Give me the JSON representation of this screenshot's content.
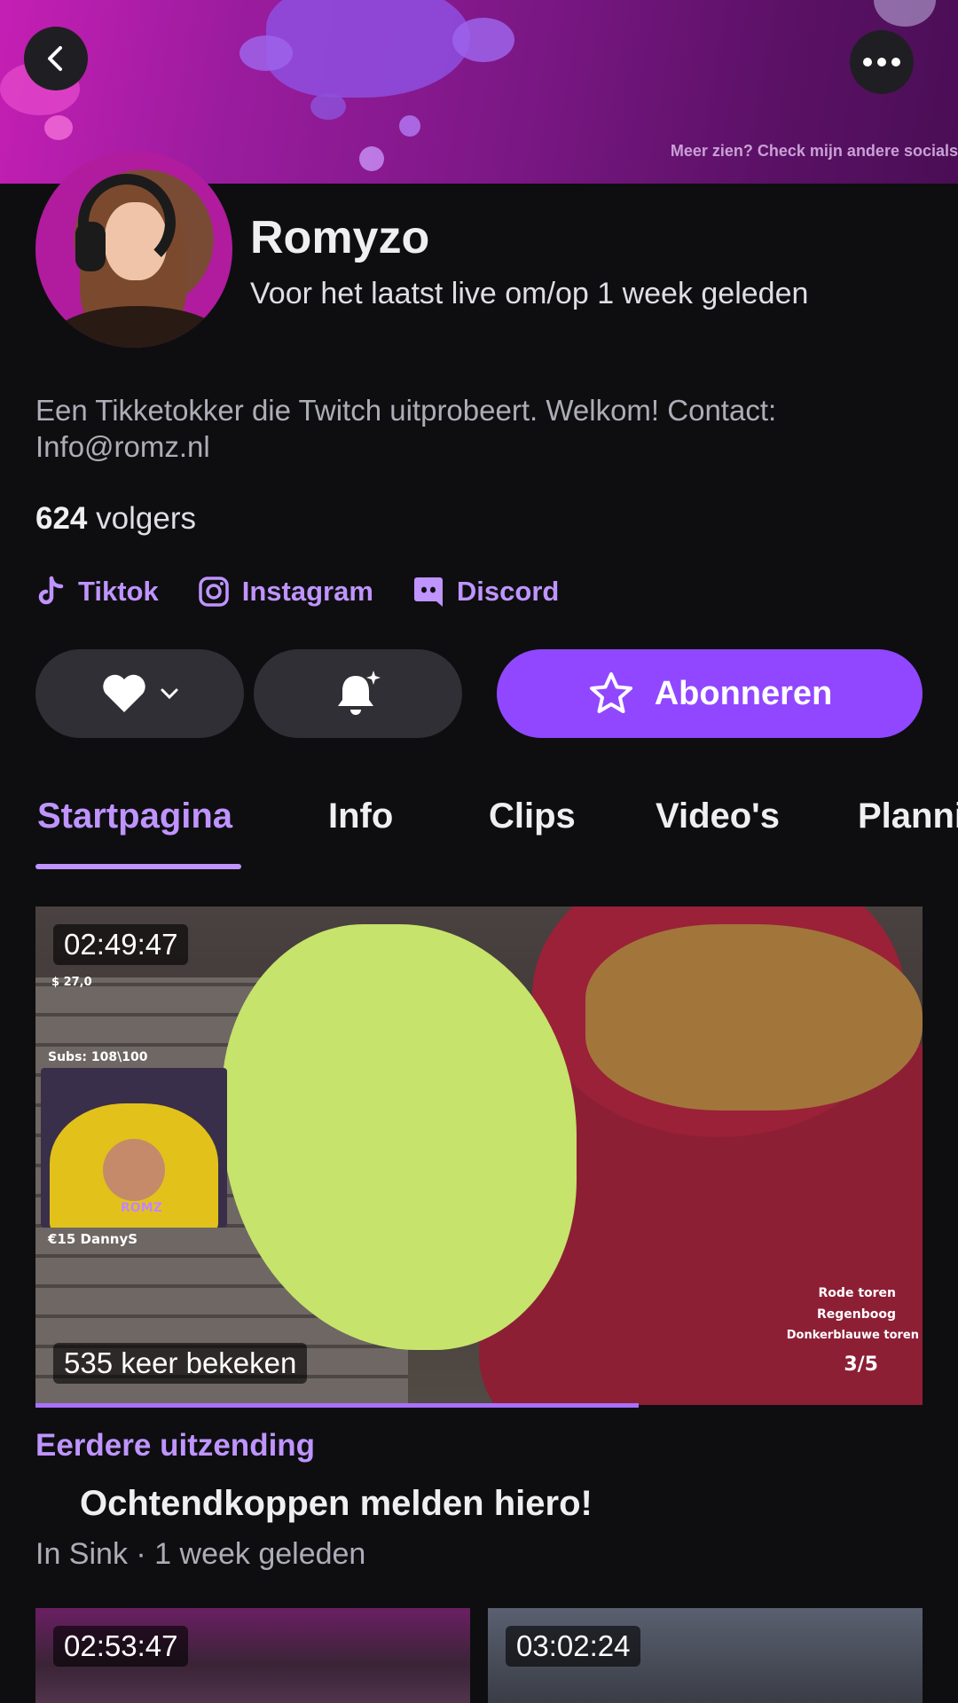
{
  "banner": {
    "text": "Meer zien? Check mijn andere socials"
  },
  "channel": {
    "name": "Romyzo",
    "last_live": "Voor het laatst live om/op 1 week geleden",
    "bio": "Een Tikketokker die Twitch uitprobeert. Welkom! Contact: Info@romz.nl",
    "followers_count": "624",
    "followers_label": "volgers"
  },
  "socials": [
    {
      "label": "Tiktok",
      "icon": "tiktok-icon"
    },
    {
      "label": "Instagram",
      "icon": "instagram-icon"
    },
    {
      "label": "Discord",
      "icon": "discord-icon"
    }
  ],
  "actions": {
    "subscribe_label": "Abonneren"
  },
  "tabs": [
    {
      "label": "Startpagina",
      "active": true
    },
    {
      "label": "Info"
    },
    {
      "label": "Clips"
    },
    {
      "label": "Video's"
    },
    {
      "label": "Planni"
    }
  ],
  "featured_video": {
    "duration": "02:49:47",
    "views": "535 keer bekeken",
    "progress": 0.68,
    "type_label": "Eerdere uitzending",
    "title": "Ochtendkoppen melden hiero!",
    "meta": "In Sink · 1 week geleden",
    "overlay": {
      "money": "$ 27,0",
      "subs": "Subs: 108\\100",
      "donation": "€15 DannyS",
      "cam_logo": "ROMZ",
      "list": [
        "Rode toren",
        "Regenboog",
        "Donkerblauwe toren"
      ],
      "counter": "3/5"
    }
  },
  "more_videos": [
    {
      "duration": "02:53:47"
    },
    {
      "duration": "03:02:24"
    }
  ],
  "colors": {
    "accent": "#bf94ff",
    "primary": "#9147ff",
    "background": "#0e0e10"
  }
}
